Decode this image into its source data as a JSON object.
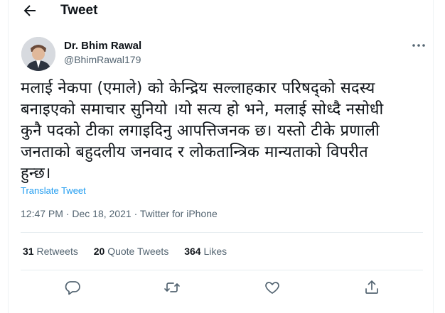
{
  "header": {
    "title": "Tweet"
  },
  "author": {
    "name": "Dr. Bhim Rawal",
    "handle": "@BhimRawal179"
  },
  "tweet": {
    "text_lines": [
      "मलाई नेकपा (एमाले) को केन्द्रिय सल्लाहकार  परिषद्को सदस्य",
      "बनाइएको समाचार सुनियो ।यो सत्य हो भने, मलाई सोध्दै नसोधी",
      "कुनै पदको टीका लगाइदिनु आपत्तिजनक छ। यस्तो टीके प्रणाली",
      "जनताको बहुदलीय जनवाद र लोकतान्त्रिक मान्यताको विपरीत",
      "हुन्छ।"
    ],
    "translate_label": "Translate Tweet",
    "time": "12:47 PM",
    "separator1": " · ",
    "date": "Dec 18, 2021",
    "separator2": " · ",
    "source": "Twitter for iPhone"
  },
  "stats": {
    "retweets_count": "31",
    "retweets_label": "Retweets",
    "quotes_count": "20",
    "quotes_label": "Quote Tweets",
    "likes_count": "364",
    "likes_label": "Likes"
  },
  "icons": {
    "back": "back-arrow-icon",
    "more": "more-dots-icon",
    "reply": "reply-icon",
    "retweet": "retweet-icon",
    "like": "heart-icon",
    "share": "share-icon"
  },
  "colors": {
    "link": "#1d9bf0",
    "muted": "#536471",
    "text": "#0f1419"
  }
}
